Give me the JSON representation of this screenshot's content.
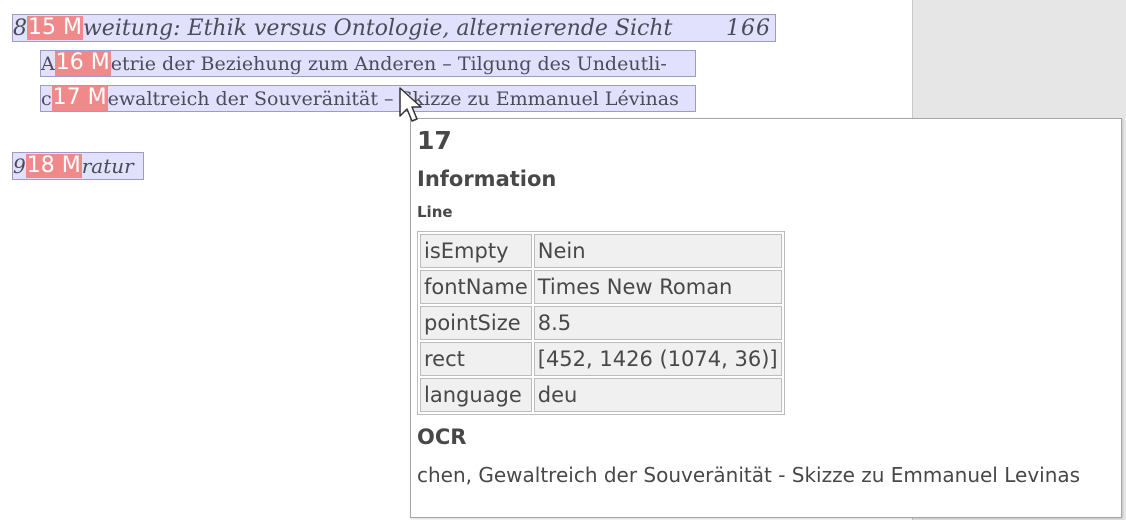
{
  "lines": {
    "line15": {
      "prefix": "8",
      "badge": "15 M",
      "text": "weitung: Ethik versus Ontologie, alternierende Sicht",
      "page": "166"
    },
    "line16": {
      "prefix": "A",
      "badge": "16 M",
      "text": "etrie der Beziehung zum Anderen – Tilgung des Undeutli-"
    },
    "line17": {
      "prefix": "c",
      "badge": "17 M",
      "text": "ewaltreich der Souveränität – Skizze zu Emmanuel Lévinas"
    },
    "line18": {
      "prefix": "9",
      "badge": "18 M",
      "text": "ratur"
    }
  },
  "info": {
    "title": "17",
    "heading": "Information",
    "subheading": "Line",
    "properties": [
      {
        "key": "isEmpty",
        "value": "Nein"
      },
      {
        "key": "fontName",
        "value": "Times New Roman"
      },
      {
        "key": "pointSize",
        "value": "8.5"
      },
      {
        "key": "rect",
        "value": "[452, 1426 (1074, 36)]"
      },
      {
        "key": "language",
        "value": "deu"
      }
    ],
    "ocr_heading": "OCR",
    "ocr_text": "chen, Gewaltreich der Souveränität - Skizze zu Emmanuel Levinas"
  },
  "colors": {
    "line_highlight": "#d7d7fc",
    "badge": "#f08a8a",
    "gutter": "#e6e6e6"
  }
}
